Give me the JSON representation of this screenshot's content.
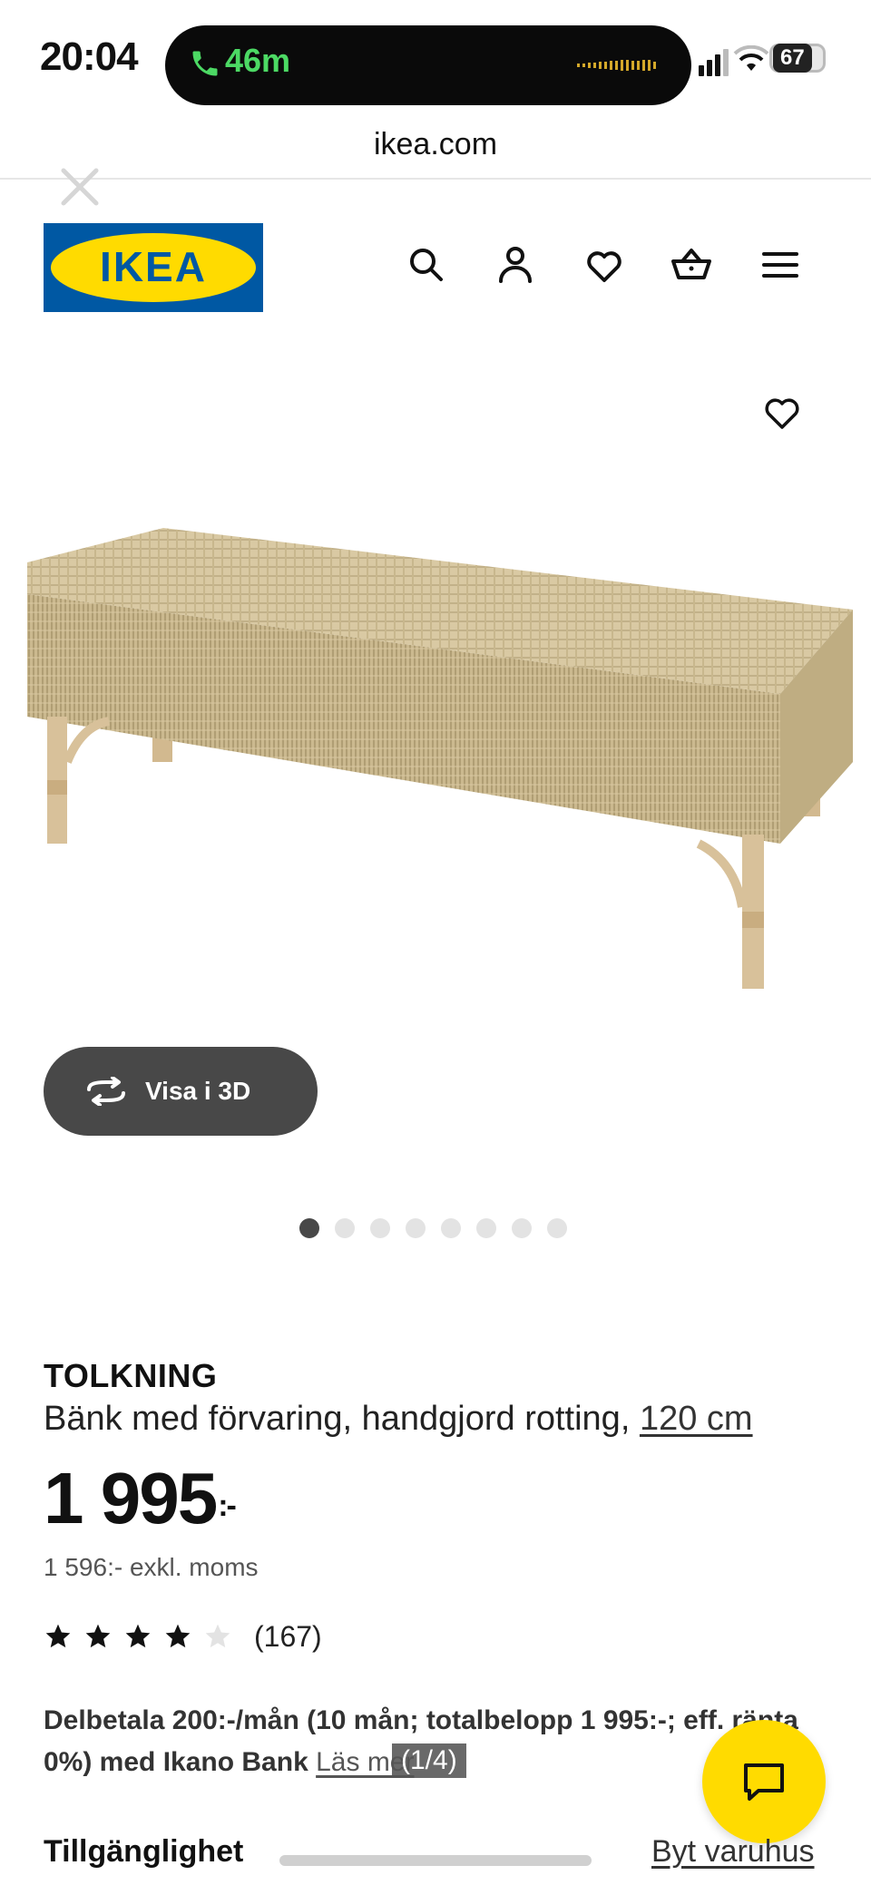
{
  "status_bar": {
    "time": "20:04",
    "call_duration": "46m",
    "battery": "67"
  },
  "browser": {
    "url": "ikea.com"
  },
  "header": {
    "logo_text": "IKEA",
    "icons": [
      "search-icon",
      "account-icon",
      "heart-icon",
      "basket-icon",
      "menu-icon"
    ]
  },
  "gallery": {
    "view_3d_label": "Visa i 3D",
    "dots_total": 8,
    "dots_active": 1
  },
  "product": {
    "name": "TOLKNING",
    "description": "Bänk med förvaring, handgjord rotting,",
    "size": "120 cm",
    "price": "1 995",
    "price_suffix": ":-",
    "price_excl": "1 596:- exkl. moms",
    "rating_stars": 4,
    "rating_max": 5,
    "rating_count": "(167)",
    "installment_text": "Delbetala 200:-/mån (10 mån; totalbelopp 1 995:-; eff. ränta 0%) med Ikano Bank",
    "read_more": "Läs mer"
  },
  "overlay": {
    "page_indicator": "(1/4)"
  },
  "availability": {
    "label": "Tillgänglighet",
    "change_store": "Byt varuhus"
  },
  "colors": {
    "ikea_blue": "#0058a3",
    "ikea_yellow": "#ffdb00",
    "button_dark": "#484848",
    "call_green": "#4cd964"
  }
}
